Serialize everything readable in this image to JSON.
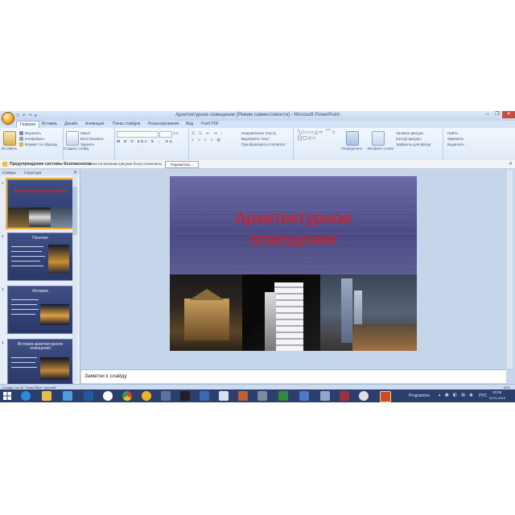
{
  "window": {
    "title": "Архитектурное освещение [Режим совместимости] - Microsoft PowerPoint",
    "quick_access": "☐ ↶ ↷ ▾",
    "controls": [
      "–",
      "❐",
      "✕"
    ]
  },
  "ribbon": {
    "tabs": [
      "Главная",
      "Вставка",
      "Дизайн",
      "Анимация",
      "Показ слайдов",
      "Рецензирование",
      "Вид",
      "Foxit PDF"
    ],
    "active_tab_index": 0,
    "groups": [
      "Буфер обмена",
      "Слайды",
      "Шрифт",
      "Абзац",
      "Рисование",
      "Редактирование"
    ],
    "clipboard": {
      "paste": "Вставить",
      "cut": "Вырезать",
      "copy": "Копировать",
      "format": "Формат по образцу"
    },
    "slides": {
      "new": "Создать слайд",
      "layout": "Макет",
      "reset": "Восстановить",
      "delete": "Удалить"
    },
    "paragraph": {
      "direction": "Направление текста",
      "align": "Выровнять текст",
      "smartart": "Преобразовать в SmartArt"
    },
    "drawing": {
      "shapes_glyphs": "╲□○▭△⇨ ⌒☆{}▢◇⌂",
      "arrange": "Упорядочить",
      "quick_styles": "Экспресс-стили",
      "fill": "Заливка фигуры",
      "outline": "Контур фигуры",
      "effects": "Эффекты для фигур"
    },
    "editing": {
      "find": "Найти",
      "replace": "Заменить",
      "select": "Выделить"
    }
  },
  "security_bar": {
    "title": "Предупреждение системы безопасности",
    "message": "Ссылки на внешние рисунки были отключены",
    "button": "Параметры..."
  },
  "left_pane": {
    "tabs": [
      "Слайды",
      "Структура"
    ],
    "slides": [
      {
        "num": "1",
        "title": "Архитектурное освещение"
      },
      {
        "num": "2",
        "title": "Понятие"
      },
      {
        "num": "3",
        "title": "История"
      },
      {
        "num": "4",
        "title": "История архитектурного освещения"
      }
    ]
  },
  "slide": {
    "title_line1": "Архитектурное",
    "title_line2": "освещение"
  },
  "notes_placeholder": "Заметки к слайду",
  "status_bar": {
    "left": "Слайд 1 из 28   \"Тема Office\"   русский",
    "zoom": "54%"
  },
  "taskbar": {
    "active_app": "Programme",
    "lang": "РУС",
    "time": "23:08",
    "date": "02.01.2016"
  },
  "colors": {
    "accent": "#2b579a",
    "slide_bg": "#5a5a94",
    "title_red": "#e01818"
  }
}
